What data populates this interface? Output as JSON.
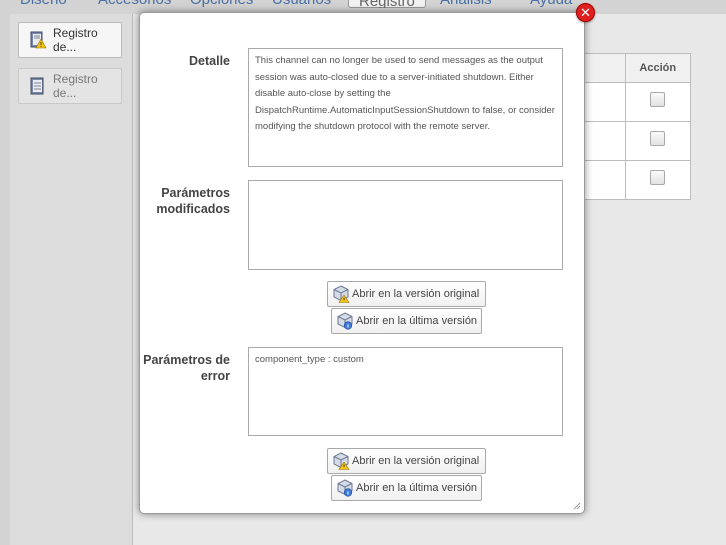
{
  "nav": {
    "tabs": [
      "Diseño",
      "Accesorios",
      "Opciones",
      "Usuarios",
      "Registro",
      "Análisis",
      "Ayuda"
    ]
  },
  "sidebar": {
    "items": [
      {
        "label": "Registro de..."
      },
      {
        "label": "Registro de..."
      }
    ]
  },
  "table": {
    "header": "Acción"
  },
  "modal": {
    "detail_label": "Detalle",
    "detail_text": "This channel can no longer be used to send messages as the output session was auto-closed due to a server-initiated shutdown. Either disable auto-close by setting the DispatchRuntime.AutomaticInputSessionShutdown to false, or consider modifying the shutdown protocol with the remote server.",
    "modified_label": "Parámetros modificados",
    "modified_text": "",
    "error_label": "Parámetros de error",
    "error_text": "component_type : custom",
    "open_original": "Abrir en la versión original",
    "open_latest": "Abrir en la última versión",
    "close_symbol": "✕"
  },
  "colors": {
    "close_button": "#e0201f",
    "nav_tab": "#4a6fa5"
  }
}
